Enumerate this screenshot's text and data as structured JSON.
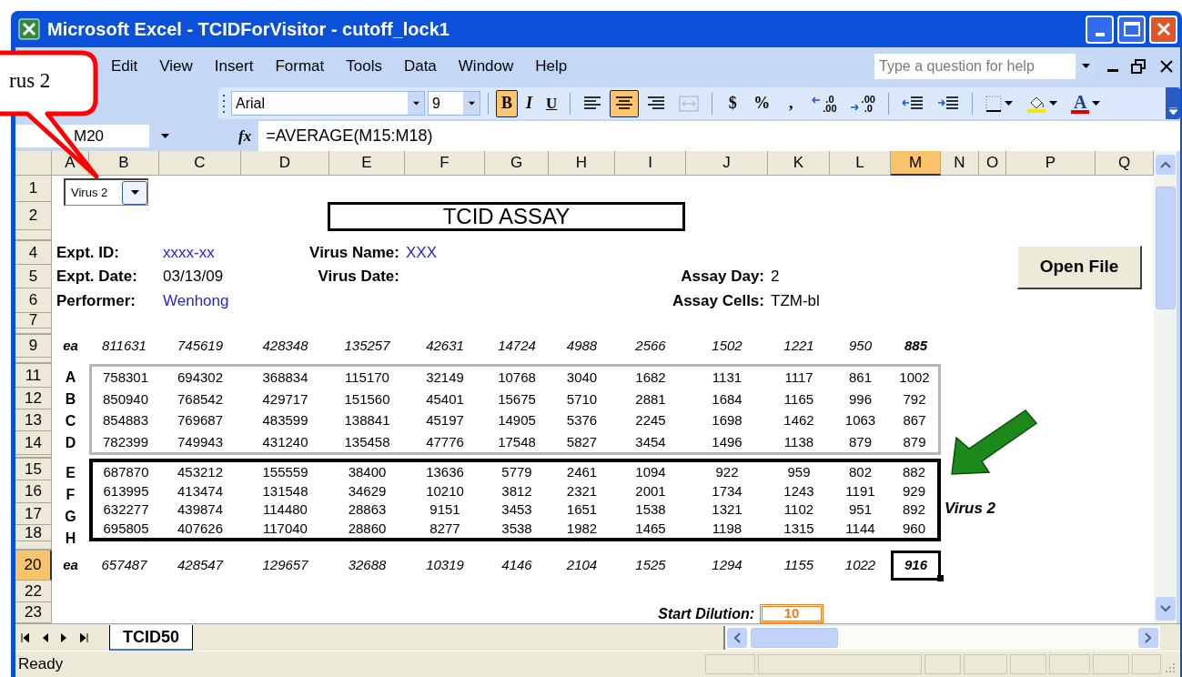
{
  "window": {
    "title": "Microsoft Excel - TCIDForVisitor - cutoff_lock1"
  },
  "callout": {
    "text": "rus 2"
  },
  "menu": [
    "Edit",
    "View",
    "Insert",
    "Format",
    "Tools",
    "Data",
    "Window",
    "Help"
  ],
  "help_field": {
    "placeholder": "Type a question for help"
  },
  "toolbar": {
    "font": "Arial",
    "size": "9",
    "groups": [
      [
        {
          "kind": "bold",
          "text": "B",
          "selected": true,
          "disabled": false
        },
        {
          "kind": "italic",
          "text": "I",
          "selected": false,
          "disabled": false
        },
        {
          "kind": "underline",
          "text": "U",
          "selected": false,
          "disabled": false
        }
      ],
      [
        {
          "kind": "align-left",
          "selected": false,
          "disabled": false
        },
        {
          "kind": "align-center",
          "selected": true,
          "disabled": false
        },
        {
          "kind": "align-right",
          "selected": false,
          "disabled": false
        },
        {
          "kind": "merge",
          "selected": false,
          "disabled": true
        }
      ],
      [
        {
          "kind": "symbol",
          "text": "$",
          "selected": false,
          "disabled": false
        },
        {
          "kind": "symbol",
          "text": "%",
          "selected": false,
          "disabled": false
        },
        {
          "kind": "symbol",
          "text": ",",
          "selected": false,
          "disabled": false
        },
        {
          "kind": "decimal-more",
          "top": ".0",
          "bottom": ".00",
          "selected": false,
          "disabled": false
        },
        {
          "kind": "decimal-less",
          "top": ".00",
          "bottom": ".0",
          "selected": false,
          "disabled": false
        }
      ],
      [
        {
          "kind": "outdent",
          "selected": false,
          "disabled": false
        },
        {
          "kind": "indent",
          "selected": false,
          "disabled": false
        }
      ],
      [
        {
          "kind": "borders",
          "selected": false,
          "disabled": false
        },
        {
          "kind": "fill",
          "selected": false,
          "disabled": false
        },
        {
          "kind": "font-color",
          "text": "A",
          "selected": false,
          "disabled": false
        }
      ]
    ]
  },
  "formula_bar": {
    "name_box": "M20",
    "fx": "fx",
    "formula": "=AVERAGE(M15:M18)"
  },
  "sheet": {
    "columns": [
      {
        "label": "A",
        "selected": false
      },
      {
        "label": "B",
        "selected": false
      },
      {
        "label": "C",
        "selected": false
      },
      {
        "label": "D",
        "selected": false
      },
      {
        "label": "E",
        "selected": false
      },
      {
        "label": "F",
        "selected": false
      },
      {
        "label": "G",
        "selected": false
      },
      {
        "label": "H",
        "selected": false
      },
      {
        "label": "I",
        "selected": false
      },
      {
        "label": "J",
        "selected": false
      },
      {
        "label": "K",
        "selected": false
      },
      {
        "label": "L",
        "selected": false
      },
      {
        "label": "M",
        "selected": true
      },
      {
        "label": "N",
        "selected": false
      },
      {
        "label": "O",
        "selected": false
      },
      {
        "label": "P",
        "selected": false
      },
      {
        "label": "Q",
        "selected": false
      }
    ],
    "rows": [
      {
        "kind": "row",
        "label": "1",
        "selected": false
      },
      {
        "kind": "row",
        "label": "2",
        "selected": false
      },
      {
        "kind": "hidden"
      },
      {
        "kind": "row",
        "label": "4",
        "selected": false
      },
      {
        "kind": "row",
        "label": "5",
        "selected": false
      },
      {
        "kind": "row",
        "label": "6",
        "selected": false
      },
      {
        "kind": "row",
        "label": "7",
        "selected": false
      },
      {
        "kind": "hidden"
      },
      {
        "kind": "row",
        "label": "9",
        "selected": false
      },
      {
        "kind": "hidden"
      },
      {
        "kind": "row",
        "label": "11",
        "selected": false
      },
      {
        "kind": "row",
        "label": "12",
        "selected": false
      },
      {
        "kind": "row",
        "label": "13",
        "selected": false
      },
      {
        "kind": "row",
        "label": "14",
        "selected": false
      },
      {
        "kind": "hidden"
      },
      {
        "kind": "row",
        "label": "15",
        "selected": false
      },
      {
        "kind": "row",
        "label": "16",
        "selected": false
      },
      {
        "kind": "row",
        "label": "17",
        "selected": false
      },
      {
        "kind": "row",
        "label": "18",
        "selected": false
      },
      {
        "kind": "hidden"
      },
      {
        "kind": "row",
        "label": "20",
        "selected": true
      },
      {
        "kind": "row",
        "label": "22",
        "selected": false
      },
      {
        "kind": "row",
        "label": "23",
        "selected": false
      }
    ],
    "dropdown": {
      "value": "Virus 2"
    },
    "title": "TCID ASSAY",
    "open_file_button": "Open File",
    "info": [
      {
        "left": {
          "label": "Expt. ID:",
          "value": "xxxx-xx",
          "color": "#1f1fe6"
        },
        "middle": {
          "label": "Virus Name:",
          "value": "XXX",
          "color": "#1f1fe6"
        }
      },
      {
        "left": {
          "label": "Expt. Date:",
          "value": "03/13/09",
          "color": "#000000"
        },
        "middle": {
          "label": "Virus Date:"
        },
        "right": {
          "label": "Assay Day:",
          "value": "2",
          "color": "#000000"
        }
      },
      {
        "left": {
          "label": "Performer:",
          "value": "Wenhong",
          "color": "#1f1fe6"
        },
        "right": {
          "label": "Assay Cells:",
          "value": "TZM-bl",
          "color": "#000000"
        }
      }
    ],
    "mean_top": {
      "label": "ea",
      "values": [
        {
          "text": "811631",
          "bold": false,
          "selected": false
        },
        {
          "text": "745619",
          "bold": false,
          "selected": false
        },
        {
          "text": "428348",
          "bold": false,
          "selected": false
        },
        {
          "text": "135257",
          "bold": false,
          "selected": false
        },
        {
          "text": "42631",
          "bold": false,
          "selected": false
        },
        {
          "text": "14724",
          "bold": false,
          "selected": false
        },
        {
          "text": "4988",
          "bold": false,
          "selected": false
        },
        {
          "text": "2566",
          "bold": false,
          "selected": false
        },
        {
          "text": "1502",
          "bold": false,
          "selected": false
        },
        {
          "text": "1221",
          "bold": false,
          "selected": false
        },
        {
          "text": "950",
          "bold": false,
          "selected": false
        },
        {
          "text": "885",
          "bold": true,
          "selected": false
        }
      ]
    },
    "groups": [
      {
        "selected": false,
        "rows": [
          {
            "label": "A",
            "values": [
              "758301",
              "694302",
              "368834",
              "115170",
              "32149",
              "10768",
              "3040",
              "1682",
              "1131",
              "1117",
              "861",
              "1002"
            ]
          },
          {
            "label": "B",
            "values": [
              "850940",
              "768542",
              "429717",
              "151560",
              "45401",
              "15675",
              "5710",
              "2881",
              "1684",
              "1165",
              "996",
              "792"
            ]
          },
          {
            "label": "C",
            "values": [
              "854883",
              "769687",
              "483599",
              "138841",
              "45197",
              "14905",
              "5376",
              "2245",
              "1698",
              "1462",
              "1063",
              "867"
            ]
          },
          {
            "label": "D",
            "values": [
              "782399",
              "749943",
              "431240",
              "135458",
              "47776",
              "17548",
              "5827",
              "3454",
              "1496",
              "1138",
              "879",
              "879"
            ]
          }
        ]
      },
      {
        "selected": true,
        "rows": [
          {
            "label": "E",
            "values": [
              "687870",
              "453212",
              "155559",
              "38400",
              "13636",
              "5779",
              "2461",
              "1094",
              "922",
              "959",
              "802",
              "882"
            ]
          },
          {
            "label": "F",
            "values": [
              "613995",
              "413474",
              "131548",
              "34629",
              "10210",
              "3812",
              "2321",
              "2001",
              "1734",
              "1243",
              "1191",
              "929"
            ]
          },
          {
            "label": "G",
            "values": [
              "632277",
              "439874",
              "114480",
              "28863",
              "9151",
              "3453",
              "1651",
              "1538",
              "1321",
              "1102",
              "951",
              "892"
            ],
            "note": "Virus 2"
          },
          {
            "label": "H",
            "values": [
              "695805",
              "407626",
              "117040",
              "28860",
              "8277",
              "3538",
              "1982",
              "1465",
              "1198",
              "1315",
              "1144",
              "960"
            ]
          }
        ]
      }
    ],
    "mean_bottom": {
      "label": "ea",
      "values": [
        {
          "text": "657487",
          "bold": false,
          "selected": false
        },
        {
          "text": "428547",
          "bold": false,
          "selected": false
        },
        {
          "text": "129657",
          "bold": false,
          "selected": false
        },
        {
          "text": "32688",
          "bold": false,
          "selected": false
        },
        {
          "text": "10319",
          "bold": false,
          "selected": false
        },
        {
          "text": "4146",
          "bold": false,
          "selected": false
        },
        {
          "text": "2104",
          "bold": false,
          "selected": false
        },
        {
          "text": "1525",
          "bold": false,
          "selected": false
        },
        {
          "text": "1294",
          "bold": false,
          "selected": false
        },
        {
          "text": "1155",
          "bold": false,
          "selected": false
        },
        {
          "text": "1022",
          "bold": false,
          "selected": false
        },
        {
          "text": "916",
          "bold": true,
          "selected": true
        }
      ]
    },
    "start_dilution": {
      "label": "Start Dilution:",
      "value": "10"
    }
  },
  "sheet_tabs": [
    {
      "label": "TCID50",
      "selected": true
    }
  ],
  "status": {
    "text": "Ready"
  }
}
